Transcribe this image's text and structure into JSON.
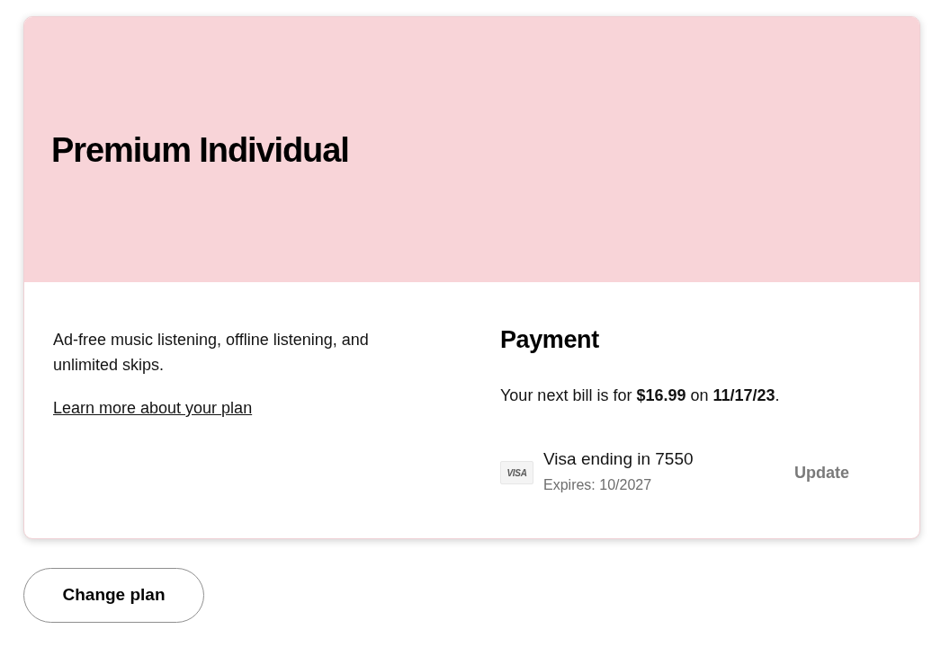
{
  "plan": {
    "title": "Premium Individual",
    "description": "Ad-free music listening, offline listening, and unlimited skips.",
    "link": "Learn more about your plan"
  },
  "payment": {
    "title": "Payment",
    "next_bill": "Your next bill is for **$16.99** on **11/17/23**.",
    "card": {
      "logo": "VISA",
      "name": "Visa ending in 7550",
      "expiry": "Expires: 10/2027"
    },
    "update_button": "Update"
  },
  "buttons": [
    "Change plan"
  ]
}
